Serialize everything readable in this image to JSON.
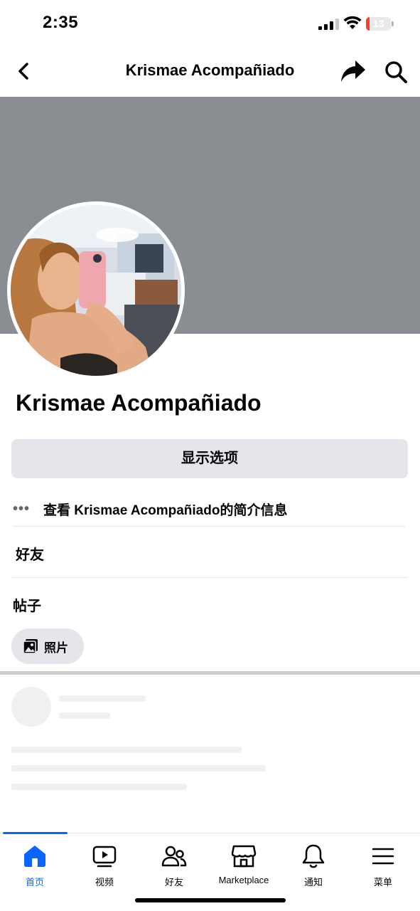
{
  "status_bar": {
    "time": "2:35",
    "battery_level": "13",
    "battery_fraction": 0.13,
    "battery_color": "#ff3b30"
  },
  "nav": {
    "title": "Krismae Acompañiado",
    "back_icon": "chevron-left-icon",
    "share_icon": "share-arrow-icon",
    "search_icon": "search-icon"
  },
  "profile": {
    "name": "Krismae Acompañiado",
    "cover_color": "#8a8d91"
  },
  "options_button": "显示选项",
  "about": {
    "dots": "•••",
    "text": "查看 Krismae Acompañiado的简介信息"
  },
  "sections": {
    "friends": "好友",
    "posts": "帖子"
  },
  "photos_chip": "照片",
  "tabs": [
    {
      "label": "首页",
      "icon": "home-icon",
      "active": true
    },
    {
      "label": "视频",
      "icon": "video-icon",
      "active": false
    },
    {
      "label": "好友",
      "icon": "friends-icon",
      "active": false
    },
    {
      "label": "Marketplace",
      "icon": "marketplace-icon",
      "active": false
    },
    {
      "label": "通知",
      "icon": "bell-icon",
      "active": false
    },
    {
      "label": "菜单",
      "icon": "menu-icon",
      "active": false
    }
  ],
  "colors": {
    "accent": "#0866ff",
    "button_bg": "#e4e6eb"
  }
}
